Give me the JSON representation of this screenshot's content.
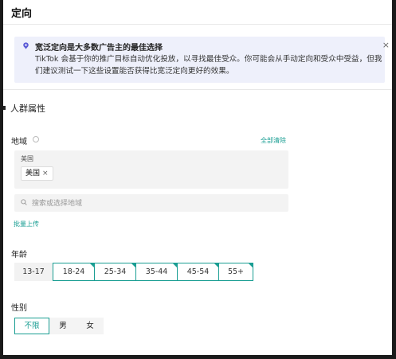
{
  "page": {
    "title": "定向"
  },
  "notice": {
    "title": "宽泛定向是大多数广告主的最佳选择",
    "body": "TikTok 会基于你的推广目标自动优化投放，以寻找最佳受众。你可能会从手动定向和受众中受益，但我们建议测试一下这些设置能否获得比宽泛定向更好的效果。",
    "close": "×"
  },
  "audience": {
    "section_title": "人群属性",
    "region": {
      "label": "地域",
      "clear_all": "全部清除",
      "country_label": "美国",
      "selected": [
        {
          "name": "美国",
          "remove": "×"
        }
      ],
      "search_placeholder": "搜索或选择地域",
      "bulk_upload": "批量上传"
    },
    "age": {
      "label": "年龄",
      "options": [
        {
          "label": "13-17",
          "selected": false
        },
        {
          "label": "18-24",
          "selected": true
        },
        {
          "label": "25-34",
          "selected": true
        },
        {
          "label": "35-44",
          "selected": true
        },
        {
          "label": "45-54",
          "selected": true
        },
        {
          "label": "55+",
          "selected": true
        }
      ]
    },
    "gender": {
      "label": "性别",
      "options": [
        {
          "label": "不限",
          "selected": true
        },
        {
          "label": "男",
          "selected": false
        },
        {
          "label": "女",
          "selected": false
        }
      ]
    }
  },
  "colors": {
    "accent": "#1a9e93",
    "notice_bg": "#eef0fb",
    "info_icon": "#5b5bd6"
  }
}
